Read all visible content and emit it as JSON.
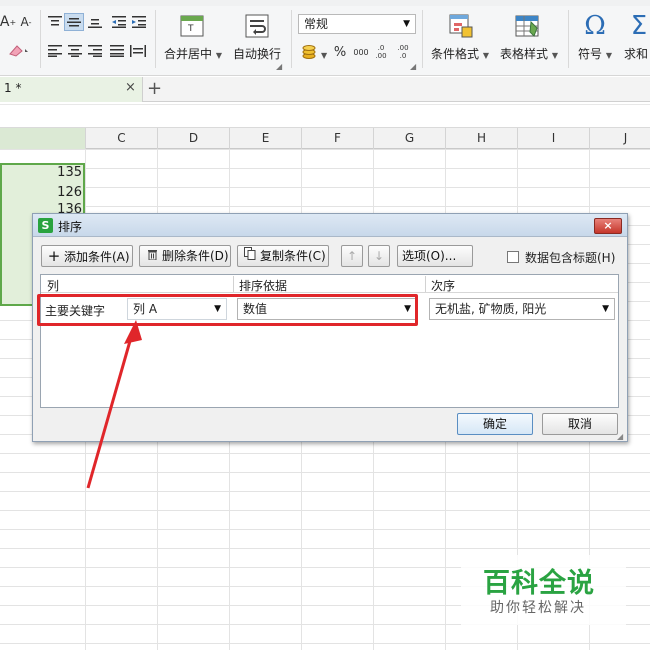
{
  "ribbon": {
    "font_inc": "A",
    "font_dec": "A",
    "number_format": "常规",
    "percent_symbol": "%",
    "comma_symbol": "000",
    "inc_decimal": ".0 .00",
    "dec_decimal": ".00 .0",
    "merge_center": "合并居中",
    "wrap_text": "自动换行",
    "conditional_format": "条件格式",
    "table_style": "表格样式",
    "symbol": "符号",
    "sum": "求和",
    "omega": "Ω",
    "sigma": "Σ"
  },
  "tabs": {
    "current": "1 *",
    "close": "×",
    "add": "+"
  },
  "grid": {
    "columns": [
      "C",
      "D",
      "E",
      "F",
      "G",
      "H",
      "I",
      "J"
    ],
    "values": [
      "135",
      "126",
      "136"
    ]
  },
  "dialog": {
    "title": "排序",
    "close": "×",
    "add_condition": "添加条件(A)",
    "delete_condition": "删除条件(D)",
    "copy_condition": "复制条件(C)",
    "move_up": "↑",
    "move_down": "↓",
    "options": "选项(O)...",
    "has_header": "数据包含标题(H)",
    "col_header": "列",
    "basis_header": "排序依据",
    "order_header": "次序",
    "row_label": "主要关键字",
    "column_value": "列 A",
    "basis_value": "数值",
    "order_value": "无机盐, 矿物质, 阳光",
    "ok": "确定",
    "cancel": "取消"
  },
  "watermark": {
    "title": "百科全说",
    "subtitle": "助你轻松解决"
  },
  "colors": {
    "accent_green": "#2aa342",
    "selection_fill": "#e2efda",
    "annotation_red": "#e0262a"
  }
}
